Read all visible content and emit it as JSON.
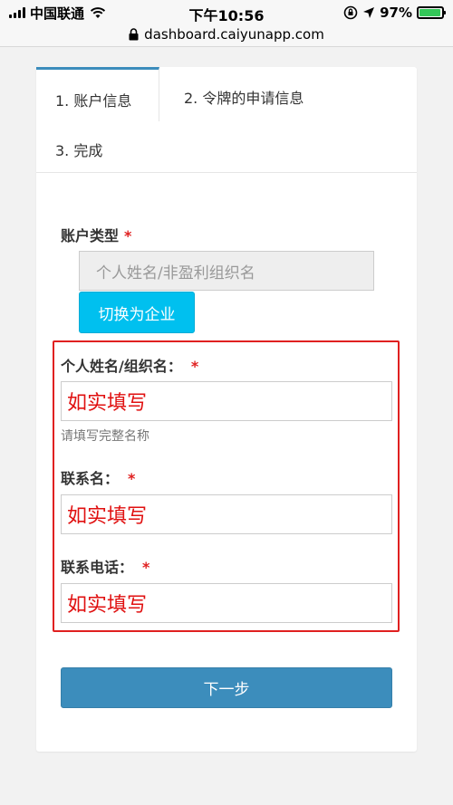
{
  "status_bar": {
    "carrier": "中国联通",
    "time": "下午10:56",
    "battery_percent": "97%",
    "battery_level": 0.97,
    "icons": [
      "signal-icon",
      "wifi-icon",
      "orientation-lock-icon",
      "location-icon",
      "battery-icon"
    ]
  },
  "browser": {
    "url": "dashboard.caiyunapp.com"
  },
  "tabs": [
    {
      "label": "1. 账户信息"
    },
    {
      "label": "2. 令牌的申请信息"
    },
    {
      "label": "3. 完成"
    }
  ],
  "account_type": {
    "label": "账户类型",
    "required_mark": "*",
    "value": "个人姓名/非盈利组织名",
    "switch_button": "切换为企业"
  },
  "fields": [
    {
      "label": "个人姓名/组织名：",
      "required_mark": "*",
      "value": "如实填写",
      "help": "请填写完整名称"
    },
    {
      "label": "联系名：",
      "required_mark": "*",
      "value": "如实填写"
    },
    {
      "label": "联系电话：",
      "required_mark": "*",
      "value": "如实填写"
    }
  ],
  "next_button": "下一步",
  "colors": {
    "primary": "#3c8dbc",
    "info": "#00c0ef",
    "required": "#e02020",
    "annotation": "#e01010"
  }
}
